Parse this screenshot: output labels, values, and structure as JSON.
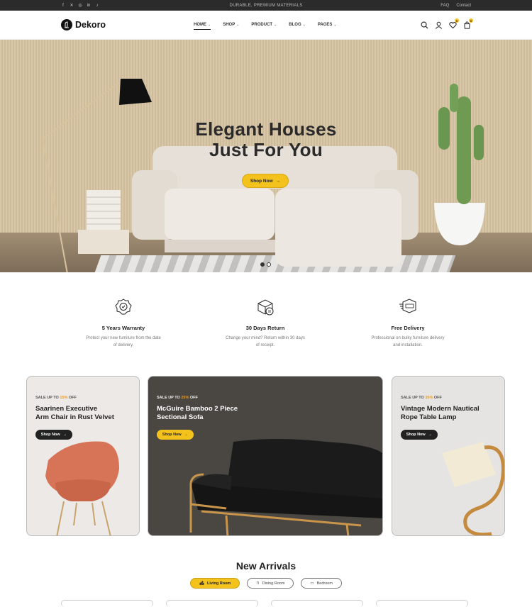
{
  "topbar": {
    "promo": "DURABLE, PREMIUM MATERIALS",
    "links": [
      "FAQ",
      "Contact"
    ],
    "social_icons": [
      "facebook-icon",
      "x-icon",
      "instagram-icon",
      "linkedin-icon",
      "tiktok-icon"
    ]
  },
  "header": {
    "brand": "Dekoro",
    "nav": [
      {
        "label": "HOME",
        "active": true
      },
      {
        "label": "SHOP"
      },
      {
        "label": "PRODUCT"
      },
      {
        "label": "BLOG"
      },
      {
        "label": "PAGES"
      }
    ],
    "wishlist_count": "0",
    "cart_count": "0"
  },
  "hero": {
    "title_line1": "Elegant Houses",
    "title_line2": "Just For You",
    "button": "Shop Now"
  },
  "features": [
    {
      "icon": "badge-icon",
      "title": "5 Years Warranty",
      "desc_line1": "Protect your new furniture from the date",
      "desc_line2": "of delivery."
    },
    {
      "icon": "return-box-icon",
      "title": "30 Days Return",
      "desc_line1": "Change your mind? Return within 30 days",
      "desc_line2": "of receipt."
    },
    {
      "icon": "free-delivery-icon",
      "title": "Free Delivery",
      "desc_line1": "Professional on bulky furniture delivery",
      "desc_line2": "and installation."
    }
  ],
  "cards": [
    {
      "sale_prefix": "SALE UP TO",
      "sale_pct": "15%",
      "sale_suffix": "OFF",
      "title_line1": "Saarinen Executive",
      "title_line2": "Arm Chair in Rust Velvet",
      "button": "Shop Now"
    },
    {
      "sale_prefix": "SALE UP TO",
      "sale_pct": "25%",
      "sale_suffix": "OFF",
      "title_line1": "McGuire Bamboo 2 Piece",
      "title_line2": "Sectional Sofa",
      "button": "Shop Now"
    },
    {
      "sale_prefix": "SALE UP TO",
      "sale_pct": "35%",
      "sale_suffix": "OFF",
      "title_line1": "Vintage Modern Nautical",
      "title_line2": "Rope Table Lamp",
      "button": "Shop Now"
    }
  ],
  "arrivals": {
    "title": "New Arrivals",
    "tabs": [
      {
        "label": "Living Room",
        "active": true
      },
      {
        "label": "Dining Room"
      },
      {
        "label": "Bedroom"
      }
    ]
  },
  "colors": {
    "accent": "#f4c21d",
    "dark": "#2b2b2b",
    "sale": "#f19a16"
  }
}
